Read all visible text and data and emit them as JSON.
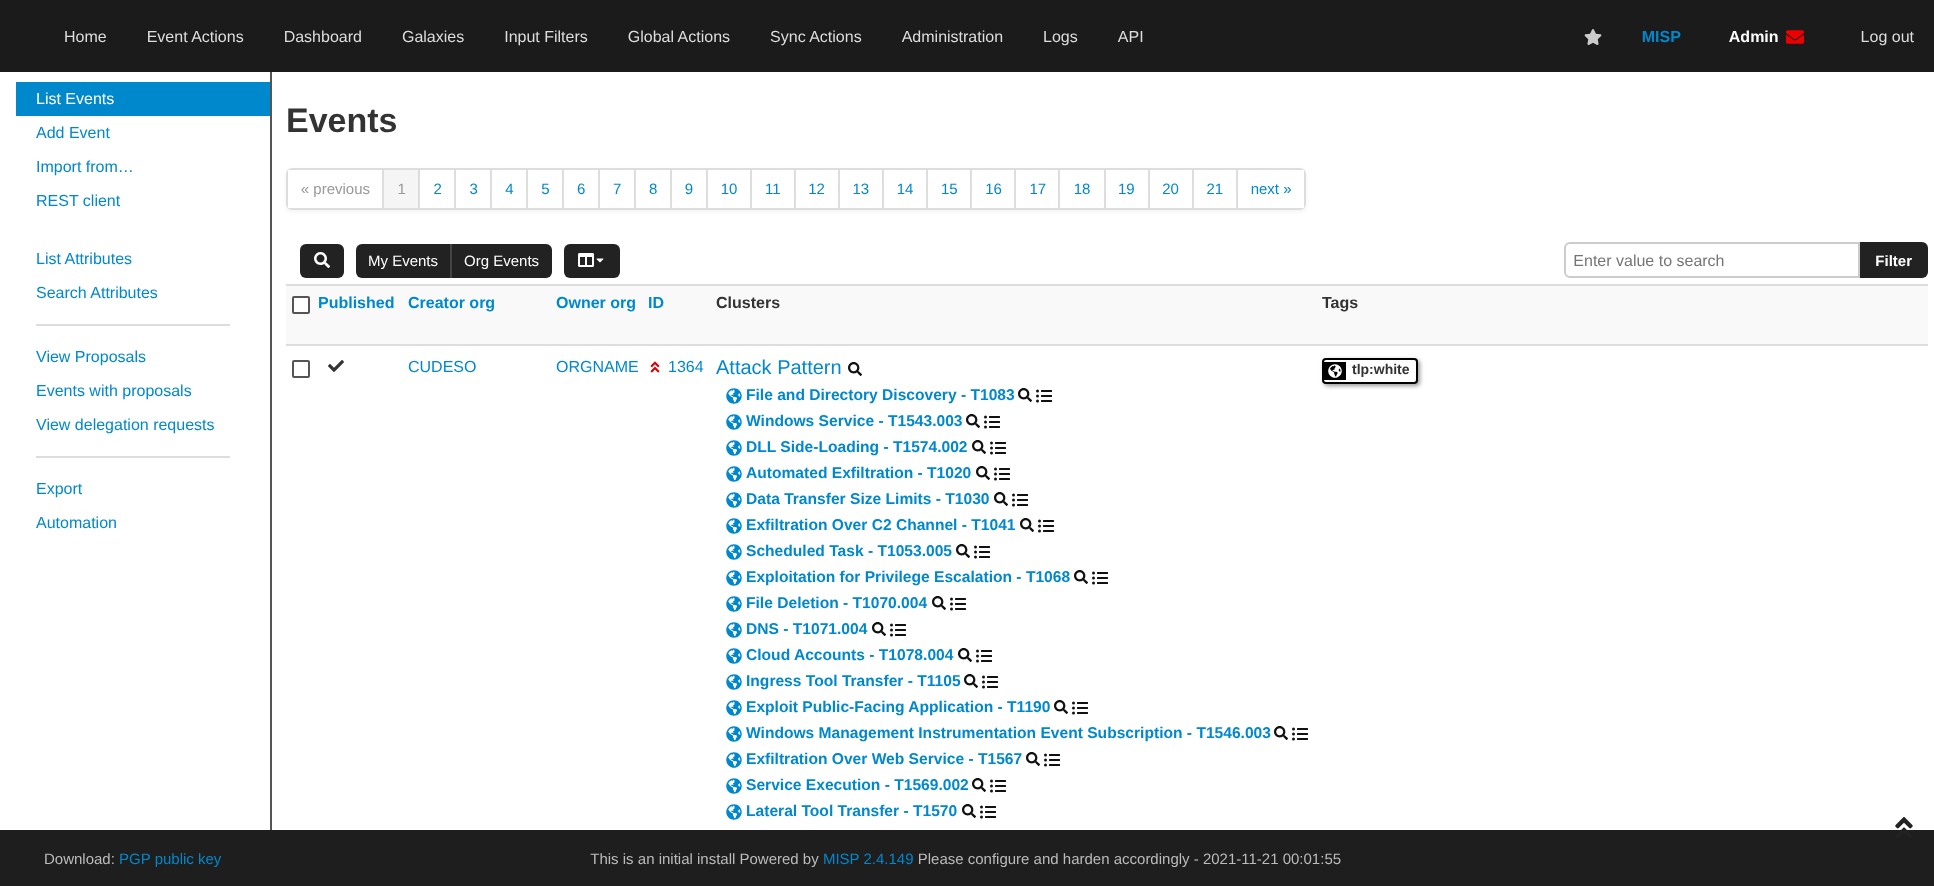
{
  "navbar": {
    "items": [
      {
        "label": "Home"
      },
      {
        "label": "Event Actions"
      },
      {
        "label": "Dashboard"
      },
      {
        "label": "Galaxies"
      },
      {
        "label": "Input Filters"
      },
      {
        "label": "Global Actions"
      },
      {
        "label": "Sync Actions"
      },
      {
        "label": "Administration"
      },
      {
        "label": "Logs"
      },
      {
        "label": "API"
      }
    ],
    "right": {
      "brand": "MISP",
      "user": "Admin",
      "logout": "Log out"
    }
  },
  "sidebar": {
    "groups": [
      [
        {
          "label": "List Events",
          "selected": true
        },
        {
          "label": "Add Event",
          "selected": false
        },
        {
          "label": "Import from…",
          "selected": false
        },
        {
          "label": "REST client",
          "selected": false
        }
      ],
      [
        {
          "label": "List Attributes",
          "selected": false
        },
        {
          "label": "Search Attributes",
          "selected": false
        }
      ],
      [
        {
          "label": "View Proposals",
          "selected": false
        },
        {
          "label": "Events with proposals",
          "selected": false
        },
        {
          "label": "View delegation requests",
          "selected": false
        }
      ],
      [
        {
          "label": "Export",
          "selected": false
        },
        {
          "label": "Automation",
          "selected": false
        }
      ]
    ]
  },
  "title": "Events",
  "pagination": {
    "previous": {
      "label": "« previous",
      "disabled": true
    },
    "pages": [
      {
        "label": "1",
        "selected": true
      },
      {
        "label": "2",
        "selected": false
      },
      {
        "label": "3",
        "selected": false
      },
      {
        "label": "4",
        "selected": false
      },
      {
        "label": "5",
        "selected": false
      },
      {
        "label": "6",
        "selected": false
      },
      {
        "label": "7",
        "selected": false
      },
      {
        "label": "8",
        "selected": false
      },
      {
        "label": "9",
        "selected": false
      },
      {
        "label": "10",
        "selected": false
      },
      {
        "label": "11",
        "selected": false
      },
      {
        "label": "12",
        "selected": false
      },
      {
        "label": "13",
        "selected": false
      },
      {
        "label": "14",
        "selected": false
      },
      {
        "label": "15",
        "selected": false
      },
      {
        "label": "16",
        "selected": false
      },
      {
        "label": "17",
        "selected": false
      },
      {
        "label": "18",
        "selected": false
      },
      {
        "label": "19",
        "selected": false
      },
      {
        "label": "20",
        "selected": false
      },
      {
        "label": "21",
        "selected": false
      }
    ],
    "next": {
      "label": "next »",
      "disabled": false
    }
  },
  "toolbar": {
    "filters": [
      "My Events",
      "Org Events"
    ],
    "search": {
      "placeholder": "Enter value to search"
    },
    "filter_button": "Filter"
  },
  "table": {
    "select_all": {
      "checked": false
    },
    "columns": [
      "Published",
      "Creator org",
      "Owner org",
      "ID",
      "Clusters",
      "Tags"
    ],
    "rows": [
      {
        "checked": false,
        "published": true,
        "creator_org": "CUDESO",
        "owner_org": "ORGNAME",
        "id": "1364",
        "cluster_group": "Attack Pattern",
        "clusters": [
          "File and Directory Discovery - T1083",
          "Windows Service - T1543.003",
          "DLL Side-Loading - T1574.002",
          "Automated Exfiltration - T1020",
          "Data Transfer Size Limits - T1030",
          "Exfiltration Over C2 Channel - T1041",
          "Scheduled Task - T1053.005",
          "Exploitation for Privilege Escalation - T1068",
          "File Deletion - T1070.004",
          "DNS - T1071.004",
          "Cloud Accounts - T1078.004",
          "Ingress Tool Transfer - T1105",
          "Exploit Public-Facing Application - T1190",
          "Windows Management Instrumentation Event Subscription - T1546.003",
          "Exfiltration Over Web Service - T1567",
          "Service Execution - T1569.002",
          "Lateral Tool Transfer - T1570"
        ],
        "tags": [
          "tlp:white"
        ]
      }
    ]
  },
  "footer": {
    "download_label": "Download:",
    "download_link": "PGP public key",
    "notice_before": "This is an initial install Powered by",
    "notice_link": "MISP 2.4.149",
    "notice_after": "Please configure and harden accordingly - 2021-11-21 00:01:55"
  }
}
